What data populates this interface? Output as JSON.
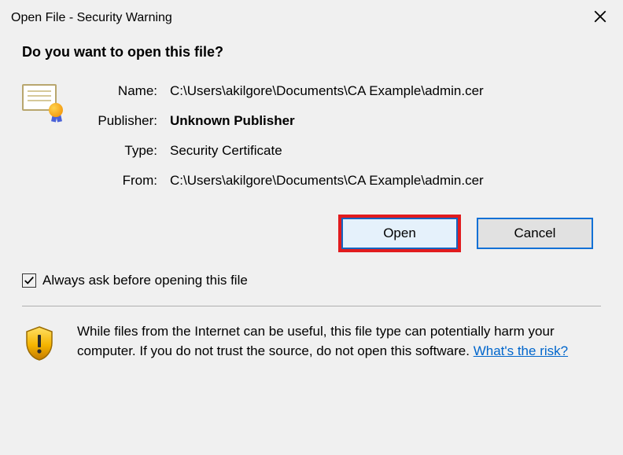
{
  "titlebar": {
    "title": "Open File - Security Warning"
  },
  "heading": "Do you want to open this file?",
  "details": {
    "name_label": "Name:",
    "name_value": "C:\\Users\\akilgore\\Documents\\CA Example\\admin.cer",
    "publisher_label": "Publisher:",
    "publisher_value": "Unknown Publisher",
    "type_label": "Type:",
    "type_value": "Security Certificate",
    "from_label": "From:",
    "from_value": "C:\\Users\\akilgore\\Documents\\CA Example\\admin.cer"
  },
  "buttons": {
    "open": "Open",
    "cancel": "Cancel"
  },
  "checkbox": {
    "label": "Always ask before opening this file",
    "checked": true
  },
  "warning": {
    "text": "While files from the Internet can be useful, this file type can potentially harm your computer. If you do not trust the source, do not open this software. ",
    "link": "What's the risk?"
  }
}
